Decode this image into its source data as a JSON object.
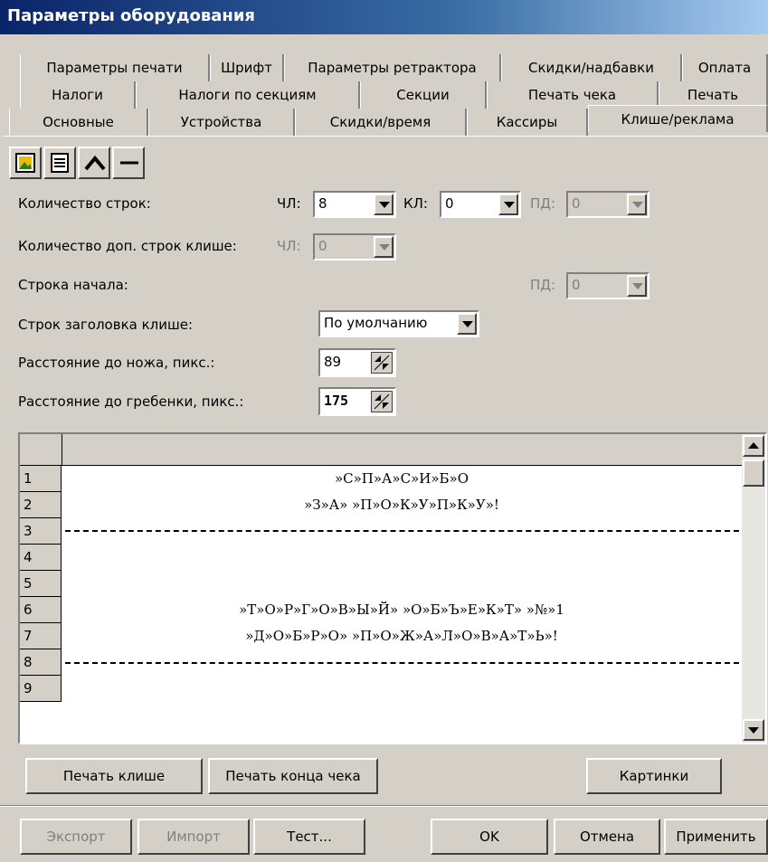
{
  "window": {
    "title": "Параметры оборудования"
  },
  "tabs": {
    "row1": [
      "Параметры печати",
      "Шрифт",
      "Параметры ретрактора",
      "Скидки/надбавки",
      "Оплата"
    ],
    "row2": [
      "Налоги",
      "Налоги по секциям",
      "Секции",
      "Печать чека",
      "Печать"
    ],
    "row3": [
      "Основные",
      "Устройства",
      "Скидки/время",
      "Кассиры",
      "Клише/реклама"
    ]
  },
  "toolbar": {
    "icons": [
      "image-icon",
      "text-icon",
      "arc-icon",
      "line-icon"
    ]
  },
  "form": {
    "line_count_label": "Количество строк:",
    "chl_label": "ЧЛ:",
    "chl_value": "8",
    "kl_label": "КЛ:",
    "kl_value": "0",
    "pd_label": "ПД:",
    "pd_value": "0",
    "extra_lines_label": "Количество доп. строк клише:",
    "extra_chl_label": "ЧЛ:",
    "extra_chl_value": "0",
    "start_line_label": "Строка начала:",
    "start_pd_label": "ПД:",
    "start_pd_value": "0",
    "header_lines_label": "Строк заголовка клише:",
    "header_lines_value": "По умолчанию",
    "knife_distance_label": "Расстояние до ножа, пикс.:",
    "knife_distance_value": "89",
    "comb_distance_label": "Расстояние до гребенки, пикс.:",
    "comb_distance_value": "175"
  },
  "grid": {
    "rows": [
      {
        "num": "1",
        "text": "»С»П»А»С»И»Б»О"
      },
      {
        "num": "2",
        "text": "»З»А» »П»О»К»У»П»К»У»!"
      },
      {
        "num": "3",
        "text": ""
      },
      {
        "num": "4",
        "text": ""
      },
      {
        "num": "5",
        "text": ""
      },
      {
        "num": "6",
        "text": "»Т»О»Р»Г»О»В»Ы»Й» »О»Б»Ъ»Е»К»Т» »№»1"
      },
      {
        "num": "7",
        "text": "»Д»О»Б»Р»О» »П»О»Ж»А»Л»О»В»А»Т»Ь»!"
      },
      {
        "num": "8",
        "text": ""
      },
      {
        "num": "9",
        "text": ""
      }
    ]
  },
  "buttons": {
    "print_cliche": "Печать клише",
    "print_receipt_end": "Печать конца чека",
    "pictures": "Картинки",
    "export": "Экспорт",
    "import": "Импорт",
    "test": "Тест...",
    "ok": "OK",
    "cancel": "Отмена",
    "apply": "Применить"
  }
}
